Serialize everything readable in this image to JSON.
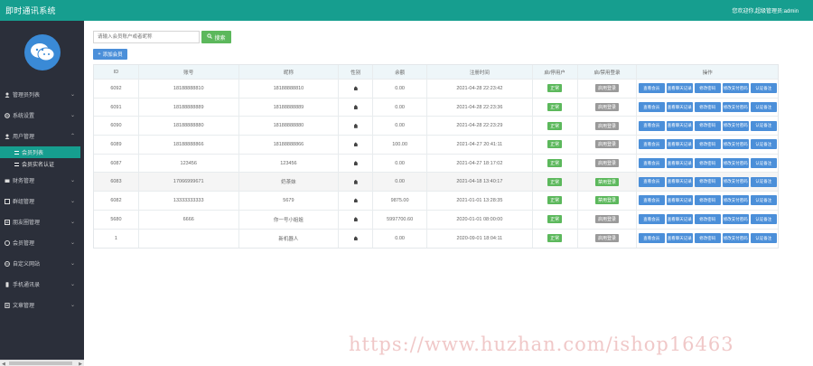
{
  "header": {
    "title": "即时通讯系统",
    "welcome": "您欢迎你,超级管理员:admin"
  },
  "sidebar": {
    "items": [
      {
        "label": "管理员列表",
        "icon": "user-icon",
        "chevron": "⌄"
      },
      {
        "label": "系统设置",
        "icon": "gear-icon",
        "chevron": "⌄"
      },
      {
        "label": "用户管理",
        "icon": "user-icon",
        "chevron": "⌃"
      },
      {
        "label": "财务管理",
        "icon": "money-icon",
        "chevron": "⌄"
      },
      {
        "label": "群组管理",
        "icon": "group-icon",
        "chevron": "⌄"
      },
      {
        "label": "朋友圈管理",
        "icon": "moments-icon",
        "chevron": "⌄"
      },
      {
        "label": "会员管理",
        "icon": "member-icon",
        "chevron": "⌄"
      },
      {
        "label": "自定义网站",
        "icon": "globe-icon",
        "chevron": "⌄"
      },
      {
        "label": "手机通讯录",
        "icon": "phone-icon",
        "chevron": "⌄"
      },
      {
        "label": "文章管理",
        "icon": "article-icon",
        "chevron": "⌄"
      }
    ],
    "sub_items": [
      {
        "label": "会员列表"
      },
      {
        "label": "会员实名认证"
      }
    ]
  },
  "search": {
    "placeholder": "请输入会员账户或者昵称",
    "button_label": "搜索"
  },
  "add_button": {
    "label": "添加会员"
  },
  "table": {
    "headers": [
      "ID",
      "账号",
      "昵称",
      "性别",
      "余额",
      "注册时间",
      "启/停用户",
      "启/禁用登录",
      "操作"
    ],
    "rows": [
      {
        "id": "6092",
        "account": "18188888810",
        "nickname": "18188888810",
        "balance": "0.00",
        "reg_time": "2021-04-28 22:23:42",
        "status": "正常",
        "login": "启用登录"
      },
      {
        "id": "6091",
        "account": "18188888889",
        "nickname": "18188888889",
        "balance": "0.00",
        "reg_time": "2021-04-28 22:23:36",
        "status": "正常",
        "login": "启用登录"
      },
      {
        "id": "6090",
        "account": "18188888880",
        "nickname": "18188888880",
        "balance": "0.00",
        "reg_time": "2021-04-28 22:23:29",
        "status": "正常",
        "login": "启用登录"
      },
      {
        "id": "6089",
        "account": "18188888866",
        "nickname": "18188888866",
        "balance": "100.00",
        "reg_time": "2021-04-27 20:41:11",
        "status": "正常",
        "login": "启用登录"
      },
      {
        "id": "6087",
        "account": "123456",
        "nickname": "123456",
        "balance": "0.00",
        "reg_time": "2021-04-27 18:17:02",
        "status": "正常",
        "login": "启用登录"
      },
      {
        "id": "6083",
        "account": "17066999671",
        "nickname": "奶茶妹",
        "balance": "0.00",
        "reg_time": "2021-04-18 13:40:17",
        "status": "正常",
        "login": "禁用登录"
      },
      {
        "id": "6082",
        "account": "13333333333",
        "nickname": "5679",
        "balance": "9875.00",
        "reg_time": "2021-01-01 13:28:35",
        "status": "正常",
        "login": "禁用登录"
      },
      {
        "id": "5680",
        "account": "6666",
        "nickname": "你一号小姐姐",
        "balance": "5997700.60",
        "reg_time": "2020-01-01 08:00:00",
        "status": "正常",
        "login": "启用登录"
      },
      {
        "id": "1",
        "account": "",
        "nickname": "新机器人",
        "balance": "0.00",
        "reg_time": "2020-09-01 18:04:11",
        "status": "正常",
        "login": "启用登录"
      }
    ],
    "actions": [
      "查看会员",
      "查看聊天记录",
      "修改密码",
      "修改支付密码",
      "认证备注"
    ]
  },
  "watermark": "https://www.huzhan.com/ishop16463",
  "colors": {
    "topbar": "#169e8f",
    "sidebar": "#2b2f3a",
    "primary": "#4b8fd9",
    "success": "#5cb85c"
  }
}
